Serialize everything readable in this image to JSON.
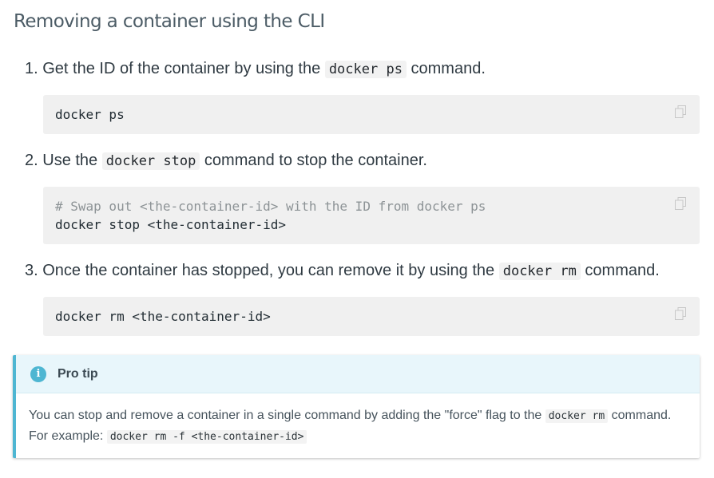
{
  "title": "Removing a container using the CLI",
  "steps": [
    {
      "number": "1.",
      "before": "Get the ID of the container by using the",
      "code": "docker ps",
      "after": "command."
    },
    {
      "number": "2.",
      "before": "Use the",
      "code": "docker stop",
      "after": "command to stop the container."
    },
    {
      "number": "3.",
      "before": "Once the container has stopped, you can remove it by using the",
      "code": "docker rm",
      "after": "command."
    }
  ],
  "code_blocks": [
    {
      "lines": [
        "docker ps"
      ]
    },
    {
      "comment": "# Swap out <the-container-id> with the ID from docker ps",
      "lines": [
        "docker stop <the-container-id>"
      ]
    },
    {
      "lines": [
        "docker rm <the-container-id>"
      ]
    }
  ],
  "copy_icon": "copy-icon",
  "tip": {
    "icon": "info-icon",
    "icon_glyph": "i",
    "title": "Pro tip",
    "text_1": "You can stop and remove a container in a single command by adding the \"force\" flag to the",
    "code_1": "docker rm",
    "text_2": "command.",
    "text_3": "For example:",
    "code_2": "docker rm -f <the-container-id>"
  },
  "colors": {
    "accent": "#4eb6d2",
    "tip_header_bg": "#e8f6fb",
    "code_bg": "#f0f0f0"
  }
}
